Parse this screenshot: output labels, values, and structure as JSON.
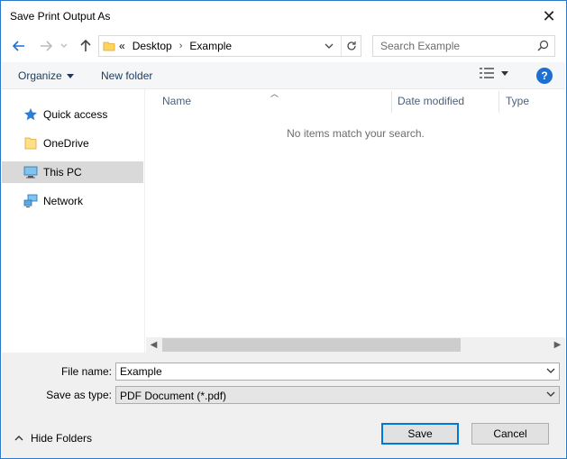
{
  "window": {
    "title": "Save Print Output As"
  },
  "address": {
    "overflow": "«",
    "crumbs": [
      "Desktop",
      "Example"
    ]
  },
  "search": {
    "placeholder": "Search Example"
  },
  "toolbar": {
    "organize_label": "Organize",
    "new_folder_label": "New folder",
    "help_label": "?"
  },
  "nav": {
    "items": [
      {
        "label": "Quick access",
        "icon": "star-icon"
      },
      {
        "label": "OneDrive",
        "icon": "folder-icon"
      },
      {
        "label": "This PC",
        "icon": "computer-icon",
        "selected": true
      },
      {
        "label": "Network",
        "icon": "network-icon"
      }
    ]
  },
  "files": {
    "columns": [
      "Name",
      "Date modified",
      "Type"
    ],
    "empty_message": "No items match your search."
  },
  "form": {
    "file_name_label": "File name:",
    "file_name_value": "Example",
    "save_type_label": "Save as type:",
    "save_type_value": "PDF Document (*.pdf)"
  },
  "footer": {
    "hide_folders_label": "Hide Folders",
    "save_label": "Save",
    "cancel_label": "Cancel"
  },
  "colors": {
    "accent": "#0078d7",
    "link": "#1e395b",
    "help": "#1e6fd1",
    "selected_nav": "#d9d9d9",
    "folder": "#ffd35c"
  }
}
